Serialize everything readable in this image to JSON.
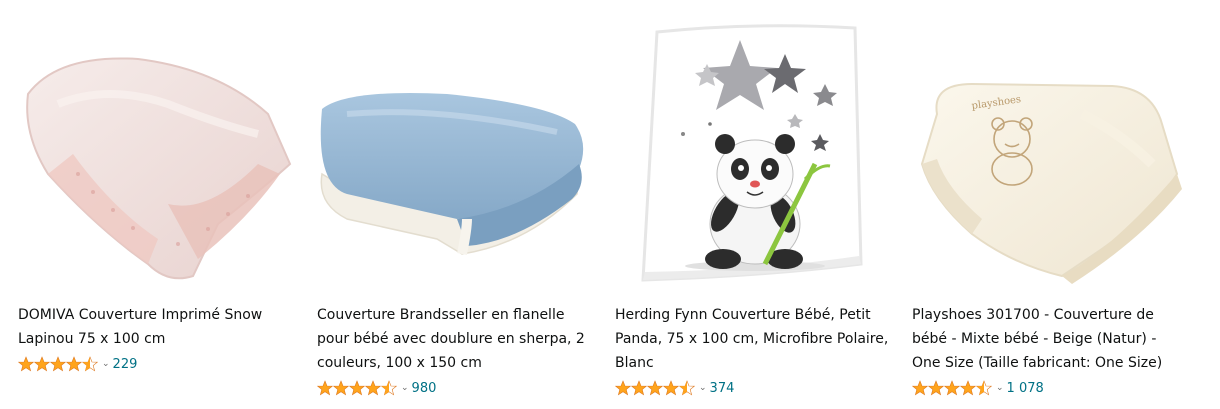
{
  "colors": {
    "link": "#007185",
    "star": "#ffa41c",
    "text": "#0f1111"
  },
  "products": [
    {
      "title": "DOMIVA Couverture Imprimé Snow Lapinou 75 x 100 cm",
      "rating": 4.5,
      "reviews": "229",
      "icon": "pink-faux-fur-blanket-image"
    },
    {
      "title": "Couverture Brandsseller en flanelle pour bébé avec doublure en sherpa, 2 couleurs, 100 x 150 cm",
      "rating": 4.5,
      "reviews": "980",
      "icon": "blue-folded-blanket-image"
    },
    {
      "title": "Herding Fynn Couverture Bébé, Petit Panda, 75 x 100 cm, Microfibre Polaire, Blanc",
      "rating": 4.5,
      "reviews": "374",
      "icon": "panda-stars-blanket-image"
    },
    {
      "title": "Playshoes 301700 - Couverture de bébé - Mixte bébé - Beige (Natur) - One Size (Taille fabricant: One Size)",
      "rating": 4.5,
      "reviews": "1 078",
      "icon": "beige-teddy-blanket-image"
    }
  ]
}
